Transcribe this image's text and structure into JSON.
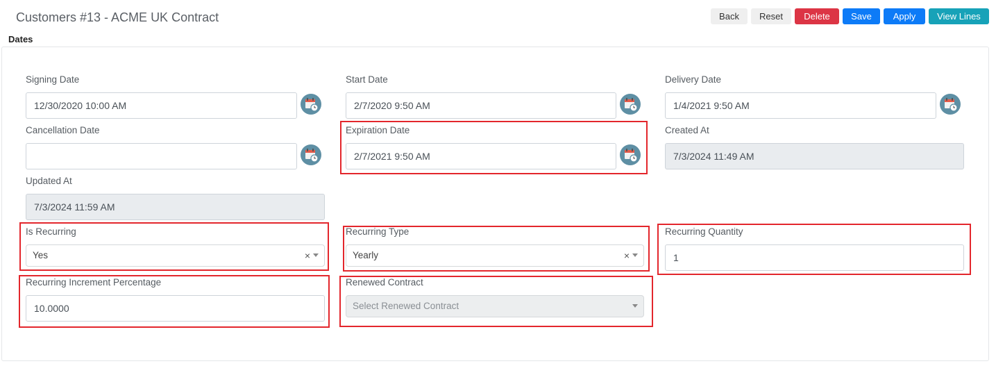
{
  "page": {
    "title": "Customers #13 - ACME UK Contract"
  },
  "toolbar": {
    "back": "Back",
    "reset": "Reset",
    "delete": "Delete",
    "save": "Save",
    "apply": "Apply",
    "view_lines": "View Lines"
  },
  "section": {
    "title": "Dates"
  },
  "fields": {
    "signing_date": {
      "label": "Signing Date",
      "value": "12/30/2020 10:00 AM"
    },
    "start_date": {
      "label": "Start Date",
      "value": "2/7/2020 9:50 AM"
    },
    "delivery_date": {
      "label": "Delivery Date",
      "value": "1/4/2021 9:50 AM"
    },
    "cancellation_date": {
      "label": "Cancellation Date",
      "value": ""
    },
    "expiration_date": {
      "label": "Expiration Date",
      "value": "2/7/2021 9:50 AM"
    },
    "created_at": {
      "label": "Created At",
      "value": "7/3/2024 11:49 AM"
    },
    "updated_at": {
      "label": "Updated At",
      "value": "7/3/2024 11:59 AM"
    },
    "is_recurring": {
      "label": "Is Recurring",
      "value": "Yes"
    },
    "recurring_type": {
      "label": "Recurring Type",
      "value": "Yearly"
    },
    "recurring_quantity": {
      "label": "Recurring Quantity",
      "value": "1"
    },
    "recurring_increment_percentage": {
      "label": "Recurring Increment Percentage",
      "value": "10.0000"
    },
    "renewed_contract": {
      "label": "Renewed Contract",
      "placeholder": "Select Renewed Contract"
    }
  },
  "select_clear_glyph": "×",
  "icons": {
    "date_picker": "calendar-clock-icon"
  },
  "colors": {
    "primary": "#0d7bf7",
    "danger": "#dc3545",
    "info": "#17a2b8",
    "highlight": "#e3262c",
    "calendar_bg": "#5e8fa4",
    "calendar_top": "#e45b4b"
  }
}
